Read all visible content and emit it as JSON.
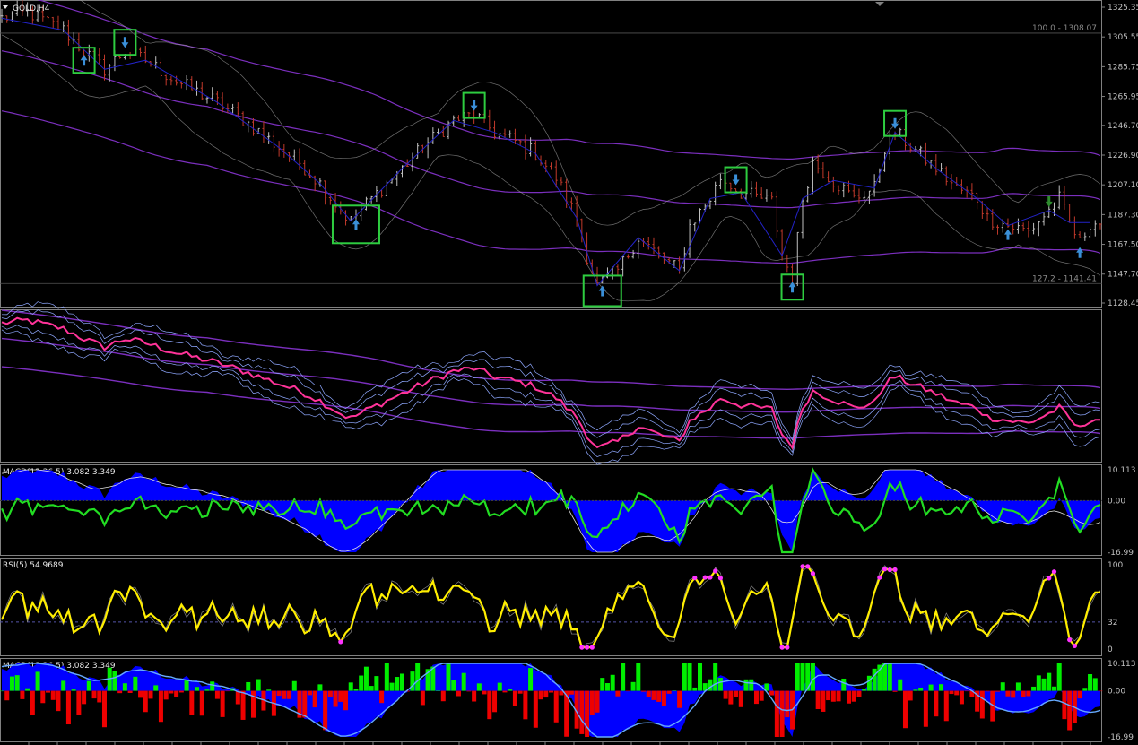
{
  "chart_data": [
    {
      "type": "candlestick",
      "title": "GOLD,H4",
      "y_ticks": [
        "1325.35",
        "1305.55",
        "1285.75",
        "1265.95",
        "1246.70",
        "1226.90",
        "1207.10",
        "1187.30",
        "1167.50",
        "1147.70",
        "1128.45"
      ],
      "ylim": [
        1128.45,
        1325.35
      ],
      "fib_levels": [
        {
          "label": "100.0 - 1308.07",
          "value": 1308.07
        },
        {
          "label": "127.2 - 1141.41",
          "value": 1141.41
        }
      ],
      "path": [
        [
          0,
          1318
        ],
        [
          5,
          1322
        ],
        [
          12,
          1310
        ],
        [
          16,
          1296
        ],
        [
          20,
          1284
        ],
        [
          24,
          1296
        ],
        [
          28,
          1290
        ],
        [
          34,
          1276
        ],
        [
          42,
          1262
        ],
        [
          48,
          1248
        ],
        [
          54,
          1232
        ],
        [
          58,
          1222
        ],
        [
          62,
          1208
        ],
        [
          66,
          1190
        ],
        [
          68,
          1183
        ],
        [
          72,
          1198
        ],
        [
          78,
          1218
        ],
        [
          82,
          1232
        ],
        [
          88,
          1250
        ],
        [
          92,
          1254
        ],
        [
          96,
          1242
        ],
        [
          100,
          1236
        ],
        [
          104,
          1228
        ],
        [
          108,
          1212
        ],
        [
          112,
          1185
        ],
        [
          114,
          1160
        ],
        [
          116,
          1140
        ],
        [
          120,
          1150
        ],
        [
          124,
          1172
        ],
        [
          128,
          1160
        ],
        [
          132,
          1150
        ],
        [
          134,
          1180
        ],
        [
          138,
          1198
        ],
        [
          140,
          1212
        ],
        [
          144,
          1202
        ],
        [
          150,
          1196
        ],
        [
          152,
          1160
        ],
        [
          154,
          1145
        ],
        [
          156,
          1198
        ],
        [
          158,
          1222
        ],
        [
          162,
          1210
        ],
        [
          166,
          1198
        ],
        [
          170,
          1205
        ],
        [
          172,
          1232
        ],
        [
          174,
          1242
        ],
        [
          178,
          1230
        ],
        [
          182,
          1218
        ],
        [
          186,
          1205
        ],
        [
          190,
          1198
        ],
        [
          192,
          1185
        ],
        [
          196,
          1180
        ],
        [
          200,
          1176
        ],
        [
          204,
          1190
        ],
        [
          206,
          1198
        ],
        [
          208,
          1182
        ],
        [
          210,
          1168
        ],
        [
          212,
          1182
        ]
      ],
      "signals": [
        {
          "t": 16,
          "dir": "up",
          "boxed": true
        },
        {
          "t": 24,
          "dir": "down",
          "boxed": true
        },
        {
          "t": 69,
          "dir": "up",
          "boxed": true
        },
        {
          "t": 92,
          "dir": "down",
          "boxed": true
        },
        {
          "t": 117,
          "dir": "up",
          "boxed": true
        },
        {
          "t": 143,
          "dir": "down",
          "boxed": true
        },
        {
          "t": 154,
          "dir": "up",
          "boxed": true
        },
        {
          "t": 174,
          "dir": "down",
          "boxed": true
        },
        {
          "t": 196,
          "dir": "up",
          "boxed": false
        },
        {
          "t": 204,
          "dir": "down",
          "boxed": false
        },
        {
          "t": 210,
          "dir": "up",
          "boxed": false
        }
      ]
    },
    {
      "type": "line",
      "title": "",
      "description_series": [
        "smoothed price (magenta)",
        "envelopes (purple)"
      ]
    },
    {
      "type": "histogram",
      "title": "MACD(12,26,5) 3.082 3.349",
      "y_ticks": [
        "10.113",
        "0.00",
        "-16.99"
      ],
      "ylim": [
        -16.99,
        10.113
      ]
    },
    {
      "type": "line",
      "title": "RSI(5) 54.9689",
      "y_ticks": [
        "100",
        "32",
        "0"
      ],
      "ylim": [
        0,
        100
      ]
    },
    {
      "type": "histogram",
      "title": "MACD(12,26,5) 3.082 3.349",
      "y_ticks": [
        "10.113",
        "0.00",
        "-16.99"
      ],
      "ylim": [
        -16.99,
        10.113
      ]
    }
  ],
  "colors": {
    "background": "#000000",
    "grid_border": "#808080",
    "bull_candle": "#c0c0c0",
    "bear_candle": "#c0392b",
    "signal_box": "#2ecc40",
    "arrow_up": "#3a8fd8",
    "arrow_down_green": "#2e8b2e",
    "envelope": "#7b2fbe",
    "bollinger": "#a0a0a0",
    "fractal_line": "#2323c8",
    "pink": "#ff3399",
    "macd_blue": "#0000ff",
    "macd_green": "#22dd22",
    "rsi_yellow": "#ffee00",
    "rsi_dot": "#ff33ff",
    "hist_green": "#00ee00",
    "hist_red": "#ee0000"
  }
}
